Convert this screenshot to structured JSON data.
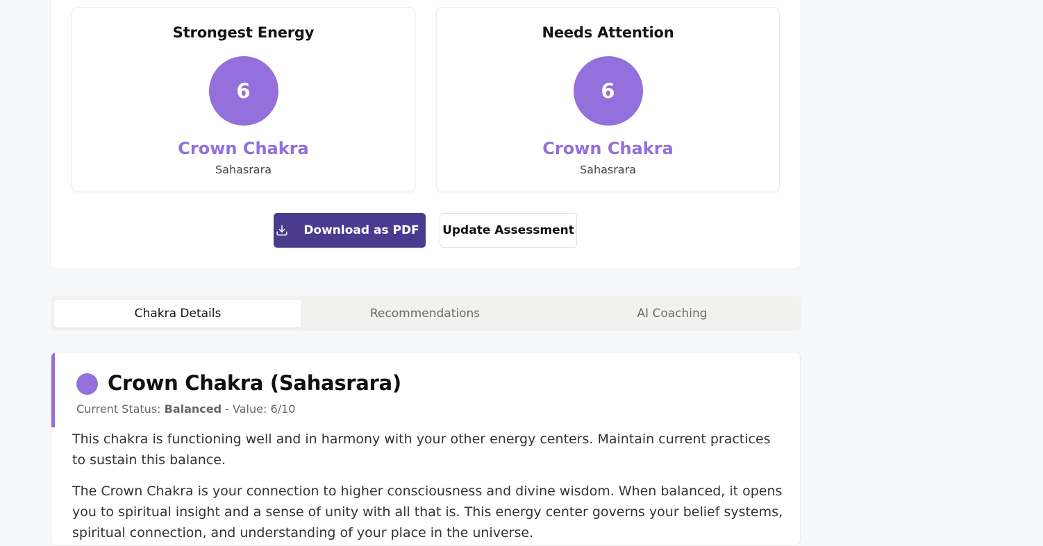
{
  "summary": {
    "strongest": {
      "title": "Strongest Energy",
      "value": "6",
      "chakra_name": "Crown Chakra",
      "sanskrit": "Sahasrara"
    },
    "attention": {
      "title": "Needs Attention",
      "value": "6",
      "chakra_name": "Crown Chakra",
      "sanskrit": "Sahasrara"
    },
    "download_label": "Download as PDF",
    "update_label": "Update Assessment"
  },
  "tabs": [
    {
      "label": "Chakra Details",
      "active": true
    },
    {
      "label": "Recommendations",
      "active": false
    },
    {
      "label": "AI Coaching",
      "active": false
    }
  ],
  "detail": {
    "title": "Crown Chakra (Sahasrara)",
    "status_prefix": "Current Status: ",
    "status_value": "Balanced",
    "status_suffix": " - Value: 6/10",
    "paragraph1": "This chakra is functioning well and in harmony with your other energy centers. Maintain current practices to sustain this balance.",
    "paragraph2": "The Crown Chakra is your connection to higher consciousness and divine wisdom. When balanced, it opens you to spiritual insight and a sense of unity with all that is. This energy center governs your belief systems, spiritual connection, and understanding of your place in the universe."
  },
  "colors": {
    "crown": "#9370db",
    "primary_button": "#4b3b8f"
  },
  "icons": {
    "download": "download-icon",
    "chakra_dot": "chakra-color-dot"
  }
}
